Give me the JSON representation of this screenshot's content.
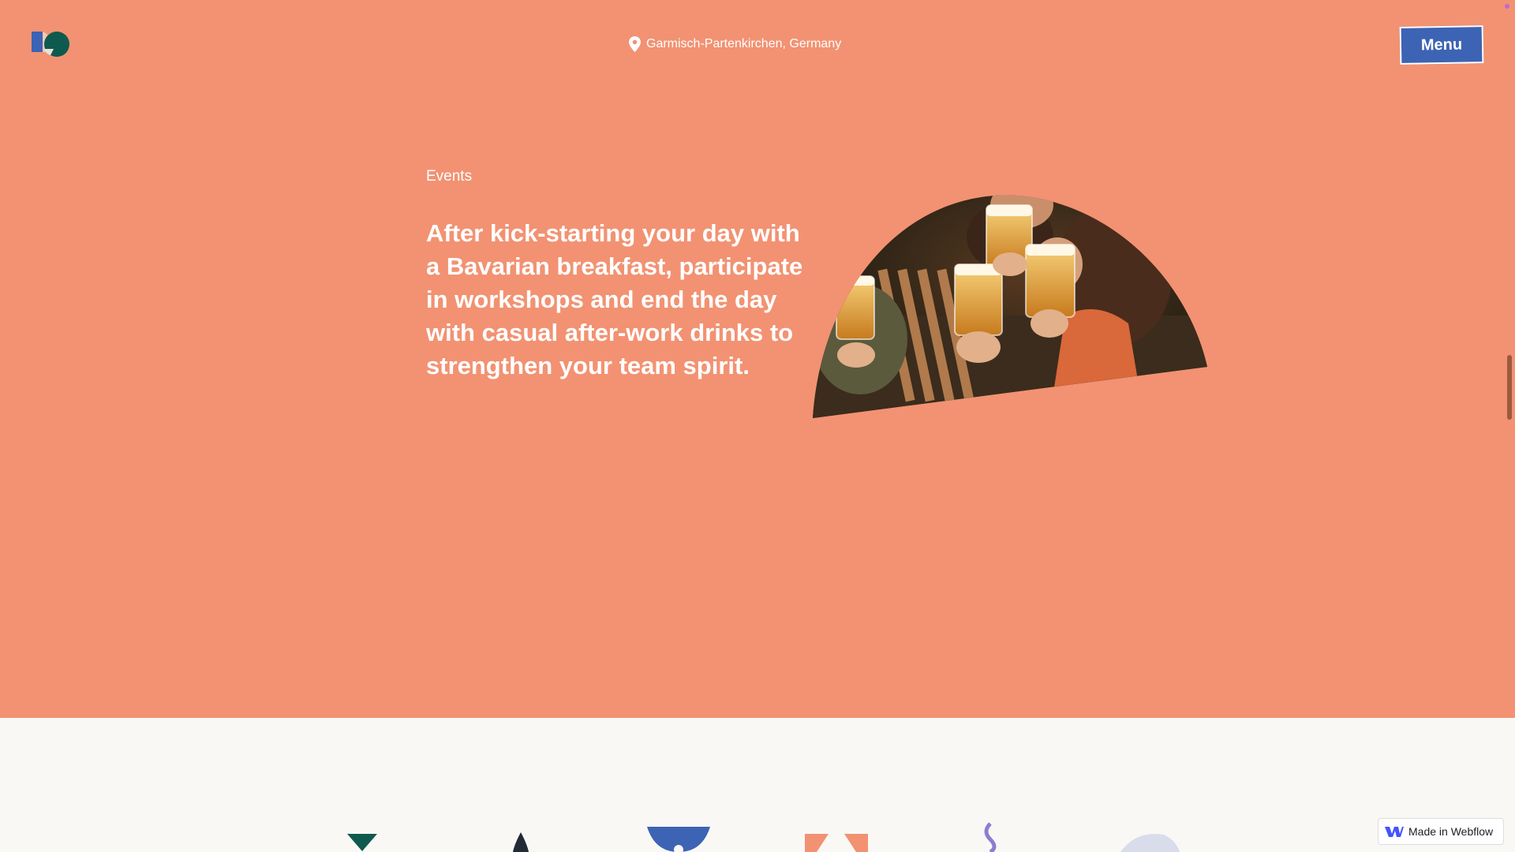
{
  "header": {
    "location": "Garmisch-Partenkirchen, Germany",
    "menu_label": "Menu"
  },
  "events": {
    "label": "Events",
    "headline": "After kick-starting your day with a Bavarian breakfast, participate in workshops and end the day with casual after-work drinks to strengthen your team spirit."
  },
  "badge": {
    "label": "Made in Webflow"
  },
  "colors": {
    "hero_background": "#f29272",
    "menu_button": "#3d63b4",
    "footer_background": "#faf8f5"
  },
  "icons": {
    "logo": "logo-mark",
    "location": "map-pin-icon",
    "webflow": "webflow-logo-icon"
  }
}
